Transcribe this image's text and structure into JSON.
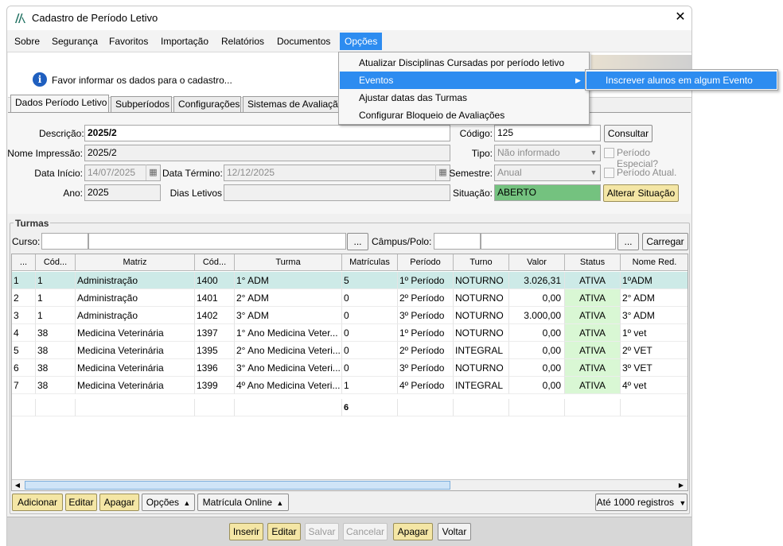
{
  "window": {
    "title": "Cadastro de Período Letivo"
  },
  "menu": [
    "Sobre",
    "Segurança",
    "Favoritos",
    "Importação",
    "Relatórios",
    "Documentos",
    "Opções"
  ],
  "info_message": "Favor informar os dados para o cadastro...",
  "tabs": [
    "Dados Período Letivo",
    "Subperíodos",
    "Configurações",
    "Sistemas de Avaliação"
  ],
  "form": {
    "descricao_label": "Descrição:",
    "descricao": "2025/2",
    "codigo_label": "Código:",
    "codigo": "125",
    "consultar": "Consultar",
    "nome_impressao_label": "Nome Impressão:",
    "nome_impressao": "2025/2",
    "tipo_label": "Tipo:",
    "tipo": "Não informado",
    "periodo_especial": "Período Especial?",
    "data_inicio_label": "Data Início:",
    "data_inicio": "14/07/2025",
    "data_termino_label": "Data Término:",
    "data_termino": "12/12/2025",
    "semestre_label": "Semestre:",
    "semestre": "Anual",
    "periodo_atual": "Período Atual.",
    "ano_label": "Ano:",
    "ano": "2025",
    "dias_letivos_label": "Dias Letivos",
    "situacao_label": "Situação:",
    "situacao": "ABERTO",
    "alterar_situacao": "Alterar Situação"
  },
  "turmas": {
    "title": "Turmas",
    "curso_label": "Curso:",
    "campus_label": "Câmpus/Polo:",
    "ellipsis": "...",
    "carregar": "Carregar",
    "columns": [
      "...",
      "Cód...",
      "Matriz",
      "Cód...",
      "Turma",
      "Matrículas",
      "Período",
      "Turno",
      "Valor",
      "Status",
      "Nome Red."
    ],
    "rows": [
      [
        "1",
        "1",
        "Administração",
        "1400",
        "1° ADM",
        "5",
        "1º Período",
        "NOTURNO",
        "3.026,31",
        "ATIVA",
        "1ºADM"
      ],
      [
        "2",
        "1",
        "Administração",
        "1401",
        "2° ADM",
        "0",
        "2º Período",
        "NOTURNO",
        "0,00",
        "ATIVA",
        "2° ADM"
      ],
      [
        "3",
        "1",
        "Administração",
        "1402",
        "3° ADM",
        "0",
        "3º Período",
        "NOTURNO",
        "3.000,00",
        "ATIVA",
        "3° ADM"
      ],
      [
        "4",
        "38",
        "Medicina Veterinária",
        "1397",
        "1°  Ano Medicina Veter...",
        "0",
        "1º Período",
        "NOTURNO",
        "0,00",
        "ATIVA",
        "1º vet"
      ],
      [
        "5",
        "38",
        "Medicina Veterinária",
        "1395",
        "2° Ano Medicina Veteri...",
        "0",
        "2º Período",
        "INTEGRAL",
        "0,00",
        "ATIVA",
        "2º VET"
      ],
      [
        "6",
        "38",
        "Medicina Veterinária",
        "1396",
        "3° Ano Medicina Veteri...",
        "0",
        "3º Período",
        "NOTURNO",
        "0,00",
        "ATIVA",
        "3º VET"
      ],
      [
        "7",
        "38",
        "Medicina Veterinária",
        "1399",
        "4º Ano Medicina Veteri...",
        "1",
        "4º Período",
        "INTEGRAL",
        "0,00",
        "ATIVA",
        "4º vet"
      ]
    ],
    "total_matriculas": "6",
    "buttons": {
      "adicionar": "Adicionar",
      "editar": "Editar",
      "apagar": "Apagar",
      "opcoes": "Opções",
      "matricula_online": "Matrícula Online",
      "registros": "Até 1000 registros"
    }
  },
  "footer": {
    "inserir": "Inserir",
    "editar": "Editar",
    "salvar": "Salvar",
    "cancelar": "Cancelar",
    "apagar": "Apagar",
    "voltar": "Voltar"
  },
  "menu_opcoes": {
    "items": [
      "Atualizar Disciplinas Cursadas por período letivo",
      "Eventos",
      "Ajustar datas das Turmas",
      "Configurar Bloqueio de Avaliações"
    ],
    "submenu_eventos": [
      "Inscrever alunos em algum Evento"
    ]
  },
  "colors": {
    "accent": "#2d8cf0",
    "status_active": "#d9f7d4",
    "situacao_bg": "#74c27f",
    "yellow_button": "#f4e6a5"
  }
}
